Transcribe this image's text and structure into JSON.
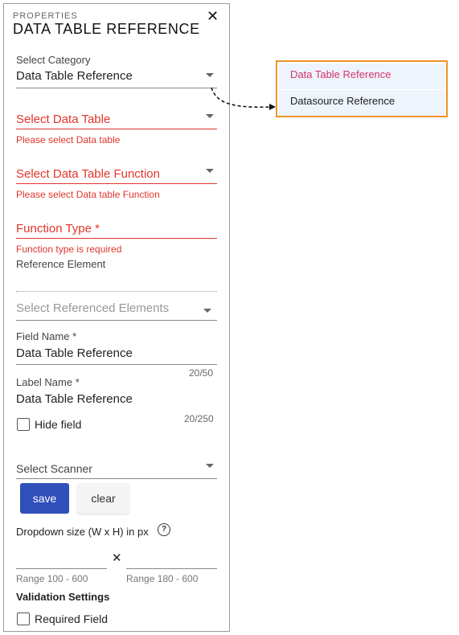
{
  "panel": {
    "eyebrow": "PROPERTIES",
    "title": "DATA TABLE REFERENCE",
    "close_glyph": "✕"
  },
  "fields": {
    "category": {
      "label": "Select Category",
      "value": "Data Table Reference"
    },
    "data_table": {
      "placeholder": "Select Data Table",
      "error": "Please select Data table"
    },
    "function": {
      "placeholder": "Select Data Table Function",
      "error": "Please select Data table Function"
    },
    "function_type": {
      "placeholder": "Function Type *",
      "error": "Function type is required"
    },
    "reference_element": {
      "label": "Reference Element"
    },
    "referenced_elements": {
      "placeholder": "Select Referenced Elements"
    },
    "field_name": {
      "label": "Field Name *",
      "value": "Data Table Reference",
      "counter": "20/50"
    },
    "label_name": {
      "label": "Label Name *",
      "value": "Data Table Reference",
      "counter": "20/250"
    },
    "hide_field": {
      "label": "Hide field"
    },
    "scanner": {
      "placeholder": "Select Scanner"
    }
  },
  "buttons": {
    "save": "save",
    "clear": "clear"
  },
  "dropdown_size": {
    "label": "Dropdown size (W x H) in px",
    "help_glyph": "?",
    "times_glyph": "✕",
    "width_range": "Range 100 - 600",
    "height_range": "Range 180 - 600"
  },
  "validation": {
    "heading": "Validation Settings",
    "required_label": "Required Field"
  },
  "popup": {
    "options": [
      "Data Table Reference",
      "Datasource Reference"
    ],
    "border_color": "#f0932b",
    "selected_color": "#d6336c"
  },
  "colors": {
    "error": "#e0352b",
    "primary": "#2f4fba"
  }
}
